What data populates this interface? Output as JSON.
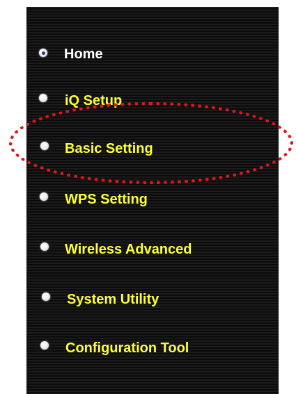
{
  "menu": {
    "items": [
      {
        "id": "home",
        "label": "Home",
        "selected": true,
        "color": "#ffffff"
      },
      {
        "id": "iq-setup",
        "label": "iQ Setup",
        "selected": false,
        "color": "#ffff33"
      },
      {
        "id": "basic-setting",
        "label": "Basic Setting",
        "selected": false,
        "color": "#ffff33",
        "highlighted": true
      },
      {
        "id": "wps-setting",
        "label": "WPS Setting",
        "selected": false,
        "color": "#ffff33"
      },
      {
        "id": "wireless-advanced",
        "label": "Wireless Advanced",
        "selected": false,
        "color": "#ffff33"
      },
      {
        "id": "system-utility",
        "label": "System Utility",
        "selected": false,
        "color": "#ffff33"
      },
      {
        "id": "configuration-tool",
        "label": "Configuration Tool",
        "selected": false,
        "color": "#ffff33"
      }
    ]
  },
  "colors": {
    "panel_background": "#141414",
    "active_label": "#ffffff",
    "inactive_label": "#ffff33",
    "highlight_ring": "#e0141c"
  }
}
